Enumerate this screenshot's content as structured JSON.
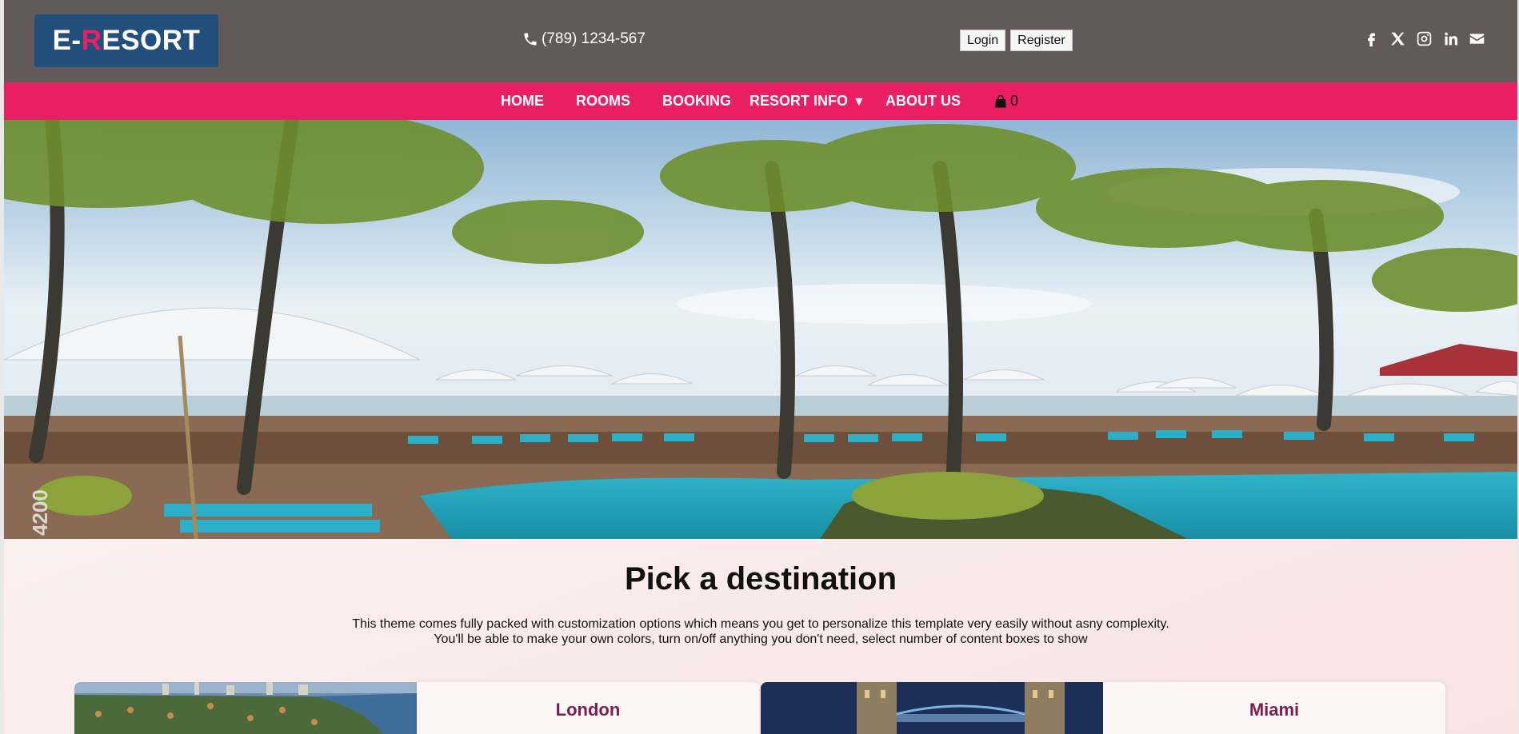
{
  "brand": {
    "logo_prefix": "E-",
    "logo_accent": "R",
    "logo_suffix": "ESORT",
    "accent_color": "#e91e63",
    "logo_bg": "#234f7c"
  },
  "header": {
    "phone": "(789) 1234-567",
    "login_label": "Login",
    "register_label": "Register",
    "social_icons": [
      "facebook-icon",
      "x-twitter-icon",
      "instagram-icon",
      "linkedin-icon",
      "mail-icon"
    ],
    "bg_color": "#615a59"
  },
  "nav": {
    "items": [
      {
        "label": "HOME"
      },
      {
        "label": "ROOMS"
      },
      {
        "label": "BOOKING"
      },
      {
        "label": "RESORT INFO",
        "caret": "▼"
      },
      {
        "label": "ABOUT US"
      }
    ],
    "cart_count": "0",
    "bg_color": "#e91e63"
  },
  "hero": {
    "image": "resort pool with palm trees and beach umbrellas",
    "watermark": "4200"
  },
  "destinations": {
    "title": "Pick a destination",
    "desc_line1": "This theme comes fully packed with customization options which means you get to personalize this template very easily without asny complexity.",
    "desc_line2": "You'll be able to make your own colors, turn on/off anything you don't need, select number of content boxes to show",
    "cards": [
      {
        "city": "London",
        "image": "aerial view of coastal city with islands"
      },
      {
        "city": "Miami",
        "image": "Tower Bridge at night"
      }
    ],
    "city_color": "#7a1f4e"
  }
}
